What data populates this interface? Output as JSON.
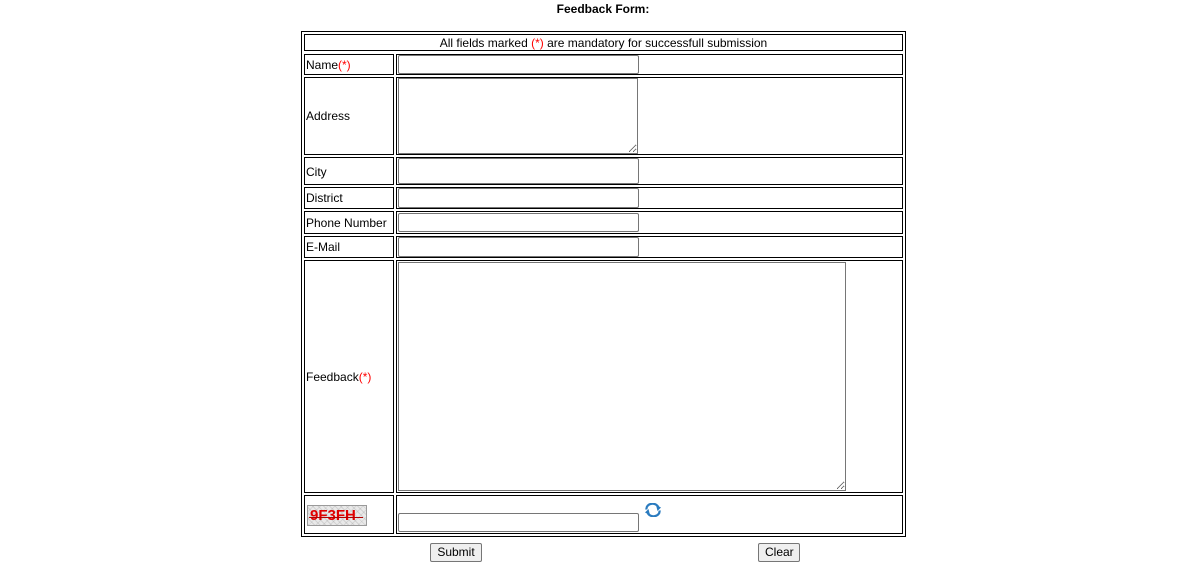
{
  "form": {
    "title": "Feedback Form:",
    "notice_prefix": "All fields marked ",
    "required_marker": "(*)",
    "notice_suffix": " are mandatory for successfull submission",
    "fields": {
      "name": {
        "label": "Name",
        "value": ""
      },
      "address": {
        "label": "Address",
        "value": ""
      },
      "city": {
        "label": "City",
        "value": ""
      },
      "district": {
        "label": "District",
        "value": ""
      },
      "phone": {
        "label": "Phone Number",
        "value": ""
      },
      "email": {
        "label": "E-Mail",
        "value": ""
      },
      "feedback": {
        "label": "Feedback ",
        "value": ""
      },
      "captcha": {
        "image_text": "9F3FH",
        "value": ""
      }
    },
    "buttons": {
      "submit": "Submit",
      "clear": "Clear"
    }
  },
  "colors": {
    "required": "#ff0000",
    "border": "#000000",
    "captcha_text": "#e00000",
    "refresh_icon": "#2a7bbf"
  },
  "icons": {
    "refresh": "refresh-icon"
  }
}
